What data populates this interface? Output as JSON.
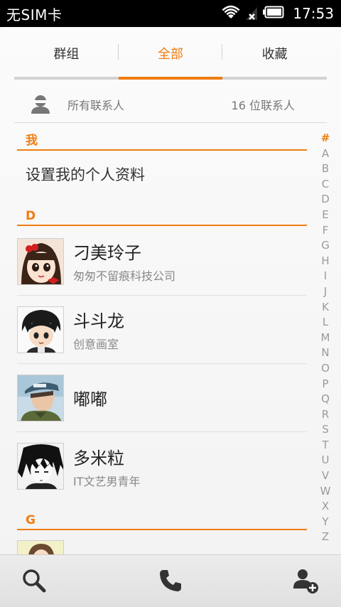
{
  "status_bar": {
    "carrier": "无SIM卡",
    "time": "17:53",
    "icons": [
      "wifi-icon",
      "no-signal-icon",
      "battery-icon"
    ]
  },
  "tabs": [
    {
      "label": "群组",
      "active": false
    },
    {
      "label": "全部",
      "active": true
    },
    {
      "label": "收藏",
      "active": false
    }
  ],
  "all_contacts": {
    "label": "所有联系人",
    "count": "16 位联系人",
    "icon": "person-icon"
  },
  "sections": {
    "me": {
      "header": "我",
      "profile_label": "设置我的个人资料"
    },
    "d": {
      "header": "D",
      "contacts": [
        {
          "name": "刁美玲子",
          "company": "匆匆不留痕科技公司",
          "avatar": "avatar-girl-red-bow"
        },
        {
          "name": "斗斗龙",
          "company": "创意画室",
          "avatar": "avatar-boy-dark-hair"
        },
        {
          "name": "嘟嘟",
          "company": "",
          "avatar": "avatar-boy-cap"
        },
        {
          "name": "多米粒",
          "company": "IT文艺男青年",
          "avatar": "avatar-boy-bw-sketch"
        }
      ]
    },
    "g": {
      "header": "G"
    }
  },
  "alpha_index": [
    "#",
    "A",
    "B",
    "C",
    "D",
    "E",
    "F",
    "G",
    "H",
    "I",
    "J",
    "K",
    "L",
    "M",
    "N",
    "O",
    "P",
    "Q",
    "R",
    "S",
    "T",
    "U",
    "V",
    "W",
    "X",
    "Y",
    "Z"
  ],
  "bottom_bar": {
    "icons": [
      "search-icon",
      "phone-icon",
      "add-contact-icon"
    ]
  },
  "colors": {
    "accent": "#f07d12",
    "status_bar_bg": "#000000",
    "text_primary": "#222222",
    "text_secondary": "#888888"
  }
}
